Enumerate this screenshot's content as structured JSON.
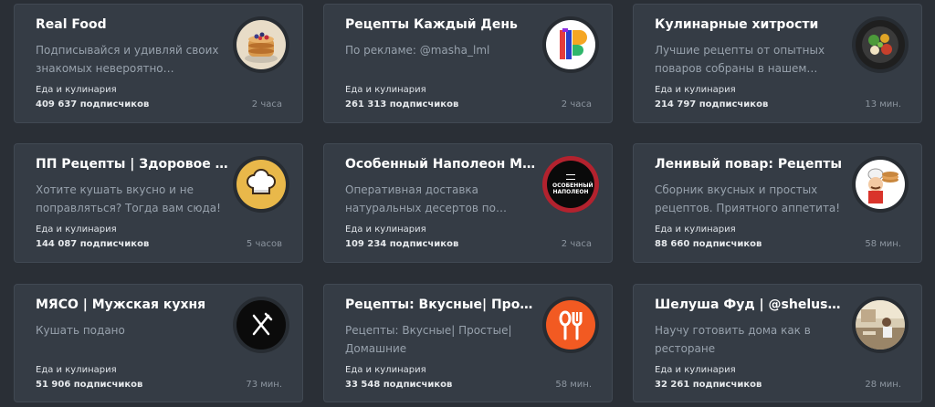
{
  "channels": [
    {
      "title": "Real Food",
      "desc": "Подписывайся и удивляй своих знакомых невероятно простыми…",
      "category": "Еда и кулинария",
      "subscribers": "409 637 подписчиков",
      "time": "2 часа",
      "icon": "pancakes-icon"
    },
    {
      "title": "Рецепты Каждый День",
      "desc": "По рекламе: @masha_lml",
      "category": "Еда и кулинария",
      "subscribers": "261 313 подписчиков",
      "time": "2 часа",
      "icon": "colorful-one-logo-icon"
    },
    {
      "title": "Кулинарные хитрости",
      "desc": "Лучшие рецепты от опытных поваров собраны в нашем…",
      "category": "Еда и кулинария",
      "subscribers": "214 797 подписчиков",
      "time": "13 мин.",
      "icon": "salad-bowl-icon"
    },
    {
      "title": "ПП Рецепты | Здоровое пит…",
      "desc": "Хотите кушать вкусно и не поправляться? Тогда вам сюда!",
      "category": "Еда и кулинария",
      "subscribers": "144 087 подписчиков",
      "time": "5 часов",
      "icon": "chef-hat-icon"
    },
    {
      "title": "Особенный Наполеон МСК",
      "desc": "Оперативная доставка натуральных десертов по Моск…",
      "category": "Еда и кулинария",
      "subscribers": "109 234 подписчиков",
      "time": "2 часа",
      "icon": "napoleon-logo-icon",
      "logo_text": "ОСОБЕННЫЙ НАПОЛЕОН"
    },
    {
      "title": "Ленивый повар: Рецепты",
      "desc": "Сборник вкусных и простых рецептов. Приятного аппетита!",
      "category": "Еда и кулинария",
      "subscribers": "88 660 подписчиков",
      "time": "58 мин.",
      "icon": "cartoon-chef-icon"
    },
    {
      "title": "МЯСО | Мужская кухня",
      "desc": "Кушать подано",
      "category": "Еда и кулинария",
      "subscribers": "51 906 подписчиков",
      "time": "73 мин.",
      "icon": "fork-knife-icon"
    },
    {
      "title": "Рецепты: Вкусные| Простые…",
      "desc": "Рецепты: Вкусные| Простые| Домашние",
      "category": "Еда и кулинария",
      "subscribers": "33 548 подписчиков",
      "time": "58 мин.",
      "icon": "spoon-fork-icon"
    },
    {
      "title": "Шелуша Фуд | @shelusha_f…",
      "desc": "Научу готовить дома как в ресторане",
      "category": "Еда и кулинария",
      "subscribers": "32 261 подписчиков",
      "time": "28 мин.",
      "icon": "kitchen-photo-icon"
    }
  ]
}
